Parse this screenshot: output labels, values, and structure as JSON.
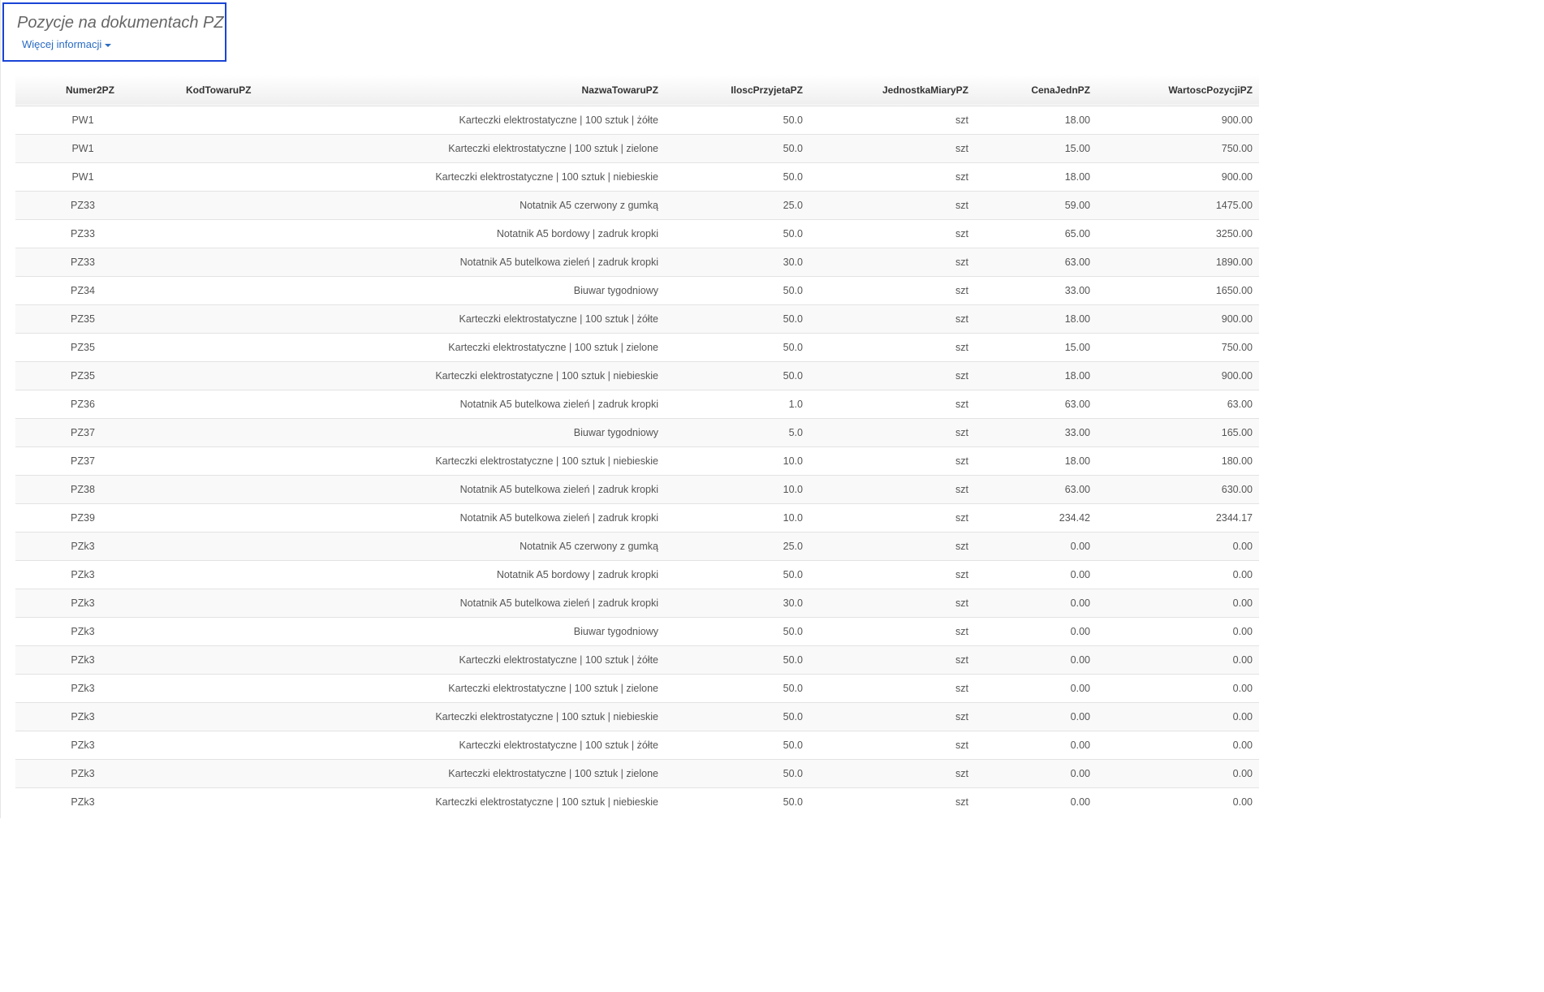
{
  "header": {
    "title": "Pozycje na dokumentach PZ",
    "more_info_label": "Więcej informacji"
  },
  "table": {
    "columns": [
      "Numer2PZ",
      "KodTowaruPZ",
      "NazwaTowaruPZ",
      "IloscPrzyjetaPZ",
      "JednostkaMiaryPZ",
      "CenaJednPZ",
      "WartoscPozycjiPZ"
    ],
    "rows": [
      [
        "PW1",
        "",
        "Karteczki elektrostatyczne | 100 sztuk | żółte",
        "50.0",
        "szt",
        "18.00",
        "900.00"
      ],
      [
        "PW1",
        "",
        "Karteczki elektrostatyczne | 100 sztuk | zielone",
        "50.0",
        "szt",
        "15.00",
        "750.00"
      ],
      [
        "PW1",
        "",
        "Karteczki elektrostatyczne | 100 sztuk | niebieskie",
        "50.0",
        "szt",
        "18.00",
        "900.00"
      ],
      [
        "PZ33",
        "",
        "Notatnik A5 czerwony z gumką",
        "25.0",
        "szt",
        "59.00",
        "1475.00"
      ],
      [
        "PZ33",
        "",
        "Notatnik A5 bordowy | zadruk kropki",
        "50.0",
        "szt",
        "65.00",
        "3250.00"
      ],
      [
        "PZ33",
        "",
        "Notatnik A5 butelkowa zieleń | zadruk kropki",
        "30.0",
        "szt",
        "63.00",
        "1890.00"
      ],
      [
        "PZ34",
        "",
        "Biuwar tygodniowy",
        "50.0",
        "szt",
        "33.00",
        "1650.00"
      ],
      [
        "PZ35",
        "",
        "Karteczki elektrostatyczne | 100 sztuk | żółte",
        "50.0",
        "szt",
        "18.00",
        "900.00"
      ],
      [
        "PZ35",
        "",
        "Karteczki elektrostatyczne | 100 sztuk | zielone",
        "50.0",
        "szt",
        "15.00",
        "750.00"
      ],
      [
        "PZ35",
        "",
        "Karteczki elektrostatyczne | 100 sztuk | niebieskie",
        "50.0",
        "szt",
        "18.00",
        "900.00"
      ],
      [
        "PZ36",
        "",
        "Notatnik A5 butelkowa zieleń | zadruk kropki",
        "1.0",
        "szt",
        "63.00",
        "63.00"
      ],
      [
        "PZ37",
        "",
        "Biuwar tygodniowy",
        "5.0",
        "szt",
        "33.00",
        "165.00"
      ],
      [
        "PZ37",
        "",
        "Karteczki elektrostatyczne | 100 sztuk | niebieskie",
        "10.0",
        "szt",
        "18.00",
        "180.00"
      ],
      [
        "PZ38",
        "",
        "Notatnik A5 butelkowa zieleń | zadruk kropki",
        "10.0",
        "szt",
        "63.00",
        "630.00"
      ],
      [
        "PZ39",
        "",
        "Notatnik A5 butelkowa zieleń | zadruk kropki",
        "10.0",
        "szt",
        "234.42",
        "2344.17"
      ],
      [
        "PZk3",
        "",
        "Notatnik A5 czerwony z gumką",
        "25.0",
        "szt",
        "0.00",
        "0.00"
      ],
      [
        "PZk3",
        "",
        "Notatnik A5 bordowy | zadruk kropki",
        "50.0",
        "szt",
        "0.00",
        "0.00"
      ],
      [
        "PZk3",
        "",
        "Notatnik A5 butelkowa zieleń | zadruk kropki",
        "30.0",
        "szt",
        "0.00",
        "0.00"
      ],
      [
        "PZk3",
        "",
        "Biuwar tygodniowy",
        "50.0",
        "szt",
        "0.00",
        "0.00"
      ],
      [
        "PZk3",
        "",
        "Karteczki elektrostatyczne | 100 sztuk | żółte",
        "50.0",
        "szt",
        "0.00",
        "0.00"
      ],
      [
        "PZk3",
        "",
        "Karteczki elektrostatyczne | 100 sztuk | zielone",
        "50.0",
        "szt",
        "0.00",
        "0.00"
      ],
      [
        "PZk3",
        "",
        "Karteczki elektrostatyczne | 100 sztuk | niebieskie",
        "50.0",
        "szt",
        "0.00",
        "0.00"
      ],
      [
        "PZk3",
        "",
        "Karteczki elektrostatyczne | 100 sztuk | żółte",
        "50.0",
        "szt",
        "0.00",
        "0.00"
      ],
      [
        "PZk3",
        "",
        "Karteczki elektrostatyczne | 100 sztuk | zielone",
        "50.0",
        "szt",
        "0.00",
        "0.00"
      ],
      [
        "PZk3",
        "",
        "Karteczki elektrostatyczne | 100 sztuk | niebieskie",
        "50.0",
        "szt",
        "0.00",
        "0.00"
      ]
    ]
  },
  "colors": {
    "highlight_border": "#1a44d6",
    "link": "#2a6cc4"
  }
}
